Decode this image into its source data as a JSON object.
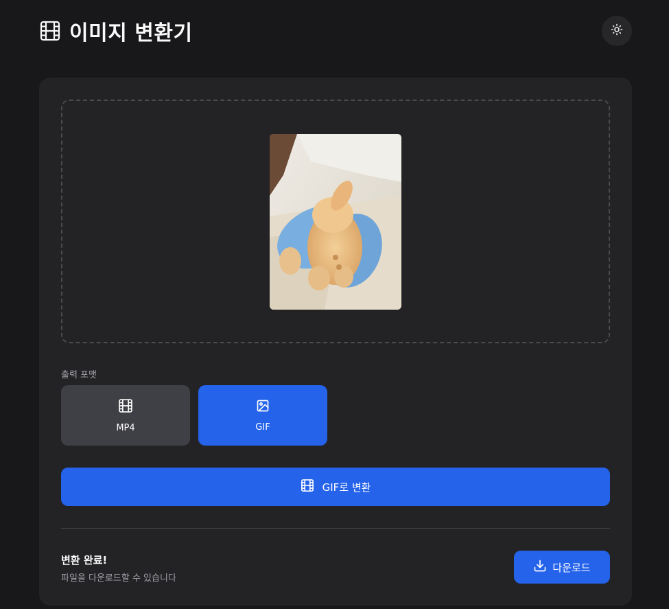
{
  "header": {
    "title": "이미지 변환기",
    "title_icon": "film-icon",
    "theme_toggle_icon": "sun-icon"
  },
  "upload": {
    "preview_description": "photo preview"
  },
  "format": {
    "label": "출력 포맷",
    "options": [
      {
        "label": "MP4",
        "icon": "film-icon",
        "selected": false
      },
      {
        "label": "GIF",
        "icon": "image-icon",
        "selected": true
      }
    ]
  },
  "convert": {
    "label": "GIF로 변환",
    "icon": "film-icon"
  },
  "result": {
    "title": "변환 완료!",
    "subtitle": "파일을 다운로드할 수 있습니다",
    "download_label": "다운로드",
    "download_icon": "download-icon"
  },
  "colors": {
    "background": "#18181b",
    "card": "#232326",
    "accent": "#2563eb",
    "unselected_option": "#3f3f46"
  }
}
